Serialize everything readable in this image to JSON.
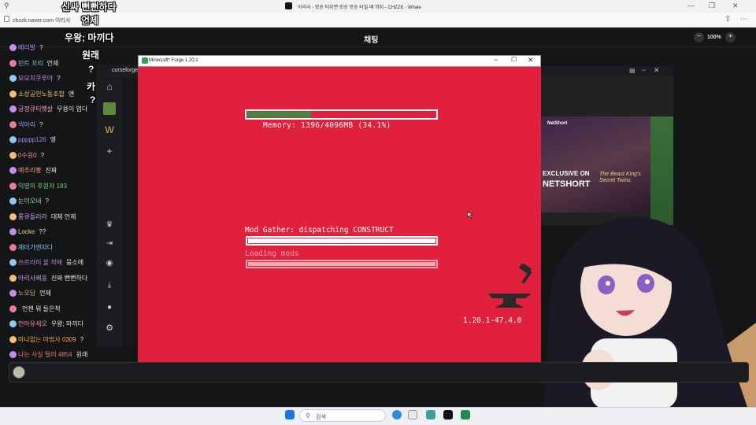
{
  "browser": {
    "window_title": "아리사 - 방송 터지면 방송 방송 터질 때 까지 - CHZZK - Whale",
    "url": "chzzk.naver.com 아리사",
    "zoom": "100%",
    "zoom_minus": "−",
    "zoom_plus": "+"
  },
  "chat": {
    "title": "채팅",
    "messages": [
      {
        "nick": "메리발",
        "text": "?",
        "nick_color": "#b48cf0"
      },
      {
        "nick": "민트 꼬리",
        "text": "언제",
        "nick_color": "#7fd1c7"
      },
      {
        "nick": "모모치쿠루아",
        "text": "?",
        "nick_color": "#c78fe8"
      },
      {
        "nick": "소상공인노동조합",
        "text": "앤",
        "nick_color": "#e6c56b"
      },
      {
        "nick": "궁정큐티햇살",
        "text": "무용이 업다",
        "nick_color": "#f0a0c0"
      },
      {
        "nick": "넥아리",
        "text": "?",
        "nick_color": "#8fa8e8"
      },
      {
        "nick": "ppppp126",
        "text": "앵",
        "nick_color": "#9f8cf0"
      },
      {
        "nick": "0수원0",
        "text": "?",
        "nick_color": "#e88f8f"
      },
      {
        "nick": "예추리빵",
        "text": "진짜",
        "nick_color": "#f09a7a"
      },
      {
        "nick": "익명의 후원자 183",
        "text": "",
        "nick_color": "#6fcf7f"
      },
      {
        "nick": "눈이오네",
        "text": "?",
        "nick_color": "#a0d8a0"
      },
      {
        "nick": "룽큐돌러라",
        "text": "대체 언제",
        "nick_color": "#c7a4f5"
      },
      {
        "nick": "Locke",
        "text": "??",
        "nick_color": "#e8d27a"
      },
      {
        "nick": "재미가엔자다",
        "text": "",
        "nick_color": "#80c8f0"
      },
      {
        "nick": "쓰르라미 울 적에",
        "text": "뭉소에",
        "nick_color": "#b38cd9"
      },
      {
        "nick": "아리사왜옹",
        "text": "진짜 뻔뻔하다",
        "nick_color": "#c8a0e8"
      },
      {
        "nick": "노오답",
        "text": "언제",
        "nick_color": "#e0b070"
      },
      {
        "nick": "",
        "text": "언젠 뭐 들은척",
        "nick_color": "#8fd0a0"
      },
      {
        "nick": "언아유세오",
        "text": "우왕; 마끼다",
        "nick_color": "#f08fa0"
      },
      {
        "nick": "마나없는 마법사 0309",
        "text": "?",
        "nick_color": "#e6a64c"
      },
      {
        "nick": "나는 사실 털러 4854",
        "text": "원래",
        "nick_color": "#e87a7a"
      }
    ]
  },
  "captions": [
    "신싸 뻔뻔하다",
    "언제",
    "우왕; 마끼다",
    "원래",
    "?",
    "카",
    "?",
    "?"
  ],
  "curseforge": {
    "title": "curseforge"
  },
  "minecraft": {
    "window_title": "Minecraft* Forge 1.20.1",
    "memory_text": "Memory: 1396/4096MB (34.1%)",
    "memory_progress": 0.341,
    "mod_gather_text": "Mod Gather: dispatching CONSTRUCT",
    "loading_text": "Loading mods",
    "version_text": "1.20.1-47.4.0"
  },
  "ad": {
    "brand": "NetShort",
    "headline": "EXCLUSIVE ON",
    "brand_big": "NETSHORT",
    "movie_title": "The Beast King's Secret Twins"
  },
  "taskbar": {
    "search_label": "검색"
  }
}
